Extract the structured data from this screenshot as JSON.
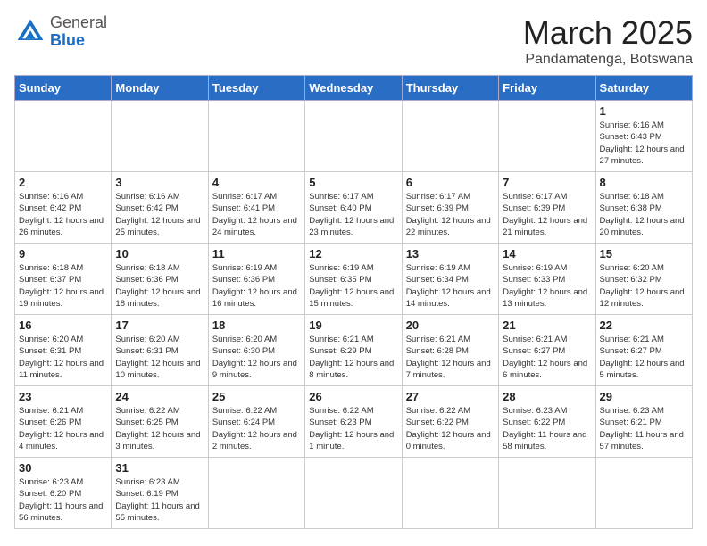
{
  "header": {
    "logo_general": "General",
    "logo_blue": "Blue",
    "month_title": "March 2025",
    "location": "Pandamatenga, Botswana"
  },
  "days_of_week": [
    "Sunday",
    "Monday",
    "Tuesday",
    "Wednesday",
    "Thursday",
    "Friday",
    "Saturday"
  ],
  "weeks": [
    [
      {
        "day": "",
        "info": ""
      },
      {
        "day": "",
        "info": ""
      },
      {
        "day": "",
        "info": ""
      },
      {
        "day": "",
        "info": ""
      },
      {
        "day": "",
        "info": ""
      },
      {
        "day": "",
        "info": ""
      },
      {
        "day": "1",
        "info": "Sunrise: 6:16 AM\nSunset: 6:43 PM\nDaylight: 12 hours and 27 minutes."
      }
    ],
    [
      {
        "day": "2",
        "info": "Sunrise: 6:16 AM\nSunset: 6:42 PM\nDaylight: 12 hours and 26 minutes."
      },
      {
        "day": "3",
        "info": "Sunrise: 6:16 AM\nSunset: 6:42 PM\nDaylight: 12 hours and 25 minutes."
      },
      {
        "day": "4",
        "info": "Sunrise: 6:17 AM\nSunset: 6:41 PM\nDaylight: 12 hours and 24 minutes."
      },
      {
        "day": "5",
        "info": "Sunrise: 6:17 AM\nSunset: 6:40 PM\nDaylight: 12 hours and 23 minutes."
      },
      {
        "day": "6",
        "info": "Sunrise: 6:17 AM\nSunset: 6:39 PM\nDaylight: 12 hours and 22 minutes."
      },
      {
        "day": "7",
        "info": "Sunrise: 6:17 AM\nSunset: 6:39 PM\nDaylight: 12 hours and 21 minutes."
      },
      {
        "day": "8",
        "info": "Sunrise: 6:18 AM\nSunset: 6:38 PM\nDaylight: 12 hours and 20 minutes."
      }
    ],
    [
      {
        "day": "9",
        "info": "Sunrise: 6:18 AM\nSunset: 6:37 PM\nDaylight: 12 hours and 19 minutes."
      },
      {
        "day": "10",
        "info": "Sunrise: 6:18 AM\nSunset: 6:36 PM\nDaylight: 12 hours and 18 minutes."
      },
      {
        "day": "11",
        "info": "Sunrise: 6:19 AM\nSunset: 6:36 PM\nDaylight: 12 hours and 16 minutes."
      },
      {
        "day": "12",
        "info": "Sunrise: 6:19 AM\nSunset: 6:35 PM\nDaylight: 12 hours and 15 minutes."
      },
      {
        "day": "13",
        "info": "Sunrise: 6:19 AM\nSunset: 6:34 PM\nDaylight: 12 hours and 14 minutes."
      },
      {
        "day": "14",
        "info": "Sunrise: 6:19 AM\nSunset: 6:33 PM\nDaylight: 12 hours and 13 minutes."
      },
      {
        "day": "15",
        "info": "Sunrise: 6:20 AM\nSunset: 6:32 PM\nDaylight: 12 hours and 12 minutes."
      }
    ],
    [
      {
        "day": "16",
        "info": "Sunrise: 6:20 AM\nSunset: 6:31 PM\nDaylight: 12 hours and 11 minutes."
      },
      {
        "day": "17",
        "info": "Sunrise: 6:20 AM\nSunset: 6:31 PM\nDaylight: 12 hours and 10 minutes."
      },
      {
        "day": "18",
        "info": "Sunrise: 6:20 AM\nSunset: 6:30 PM\nDaylight: 12 hours and 9 minutes."
      },
      {
        "day": "19",
        "info": "Sunrise: 6:21 AM\nSunset: 6:29 PM\nDaylight: 12 hours and 8 minutes."
      },
      {
        "day": "20",
        "info": "Sunrise: 6:21 AM\nSunset: 6:28 PM\nDaylight: 12 hours and 7 minutes."
      },
      {
        "day": "21",
        "info": "Sunrise: 6:21 AM\nSunset: 6:27 PM\nDaylight: 12 hours and 6 minutes."
      },
      {
        "day": "22",
        "info": "Sunrise: 6:21 AM\nSunset: 6:27 PM\nDaylight: 12 hours and 5 minutes."
      }
    ],
    [
      {
        "day": "23",
        "info": "Sunrise: 6:21 AM\nSunset: 6:26 PM\nDaylight: 12 hours and 4 minutes."
      },
      {
        "day": "24",
        "info": "Sunrise: 6:22 AM\nSunset: 6:25 PM\nDaylight: 12 hours and 3 minutes."
      },
      {
        "day": "25",
        "info": "Sunrise: 6:22 AM\nSunset: 6:24 PM\nDaylight: 12 hours and 2 minutes."
      },
      {
        "day": "26",
        "info": "Sunrise: 6:22 AM\nSunset: 6:23 PM\nDaylight: 12 hours and 1 minute."
      },
      {
        "day": "27",
        "info": "Sunrise: 6:22 AM\nSunset: 6:22 PM\nDaylight: 12 hours and 0 minutes."
      },
      {
        "day": "28",
        "info": "Sunrise: 6:23 AM\nSunset: 6:22 PM\nDaylight: 11 hours and 58 minutes."
      },
      {
        "day": "29",
        "info": "Sunrise: 6:23 AM\nSunset: 6:21 PM\nDaylight: 11 hours and 57 minutes."
      }
    ],
    [
      {
        "day": "30",
        "info": "Sunrise: 6:23 AM\nSunset: 6:20 PM\nDaylight: 11 hours and 56 minutes."
      },
      {
        "day": "31",
        "info": "Sunrise: 6:23 AM\nSunset: 6:19 PM\nDaylight: 11 hours and 55 minutes."
      },
      {
        "day": "",
        "info": ""
      },
      {
        "day": "",
        "info": ""
      },
      {
        "day": "",
        "info": ""
      },
      {
        "day": "",
        "info": ""
      },
      {
        "day": "",
        "info": ""
      }
    ]
  ]
}
